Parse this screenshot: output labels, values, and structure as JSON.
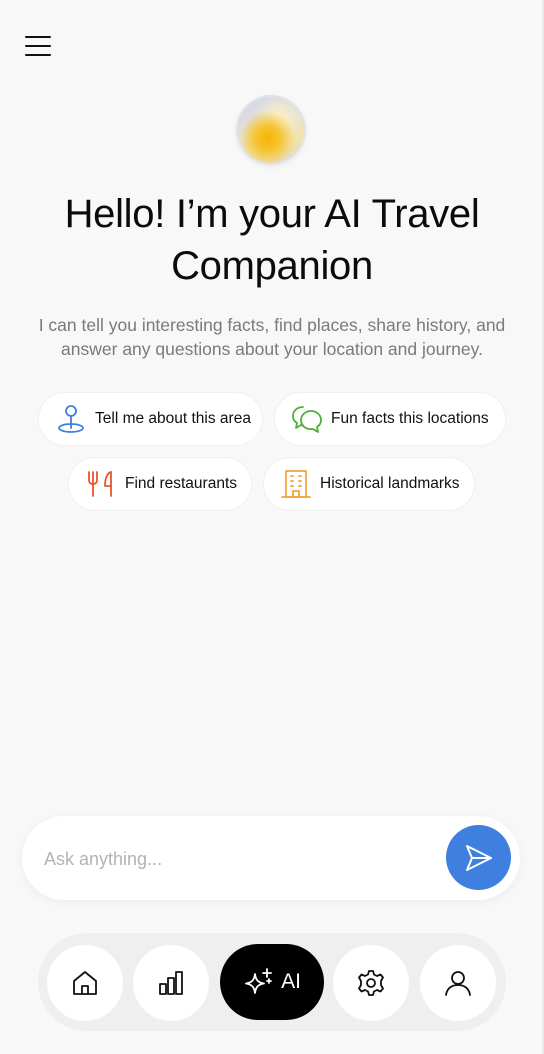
{
  "header": {
    "menu_icon": "hamburger-menu-icon"
  },
  "hero": {
    "avatar_icon": "ai-orb-avatar",
    "title_line1": "Hello! I’m your AI Travel",
    "title_line2": "Companion",
    "subtitle_line1": "I can tell you interesting facts, find places, share history, and",
    "subtitle_line2": "answer any questions about your location and journey."
  },
  "suggestions": [
    {
      "label": "Tell me about this area",
      "icon": "location-pin-icon",
      "color": "#3f7fe0"
    },
    {
      "label": "Fun facts this locations",
      "icon": "chat-bubbles-icon",
      "color": "#4caf3a"
    },
    {
      "label": "Find restaurants",
      "icon": "fork-knife-icon",
      "color": "#e8552b"
    },
    {
      "label": "Historical landmarks",
      "icon": "building-icon",
      "color": "#f0a640"
    }
  ],
  "composer": {
    "placeholder": "Ask anything...",
    "value": "",
    "send_icon": "send-icon",
    "send_color": "#3f7fe0"
  },
  "nav": {
    "items": [
      {
        "id": "home",
        "icon": "home-icon"
      },
      {
        "id": "stats",
        "icon": "bar-chart-icon"
      },
      {
        "id": "ai",
        "icon": "sparkles-icon",
        "label": "AI"
      },
      {
        "id": "settings",
        "icon": "gear-icon"
      },
      {
        "id": "profile",
        "icon": "user-icon"
      }
    ],
    "active": "ai"
  }
}
